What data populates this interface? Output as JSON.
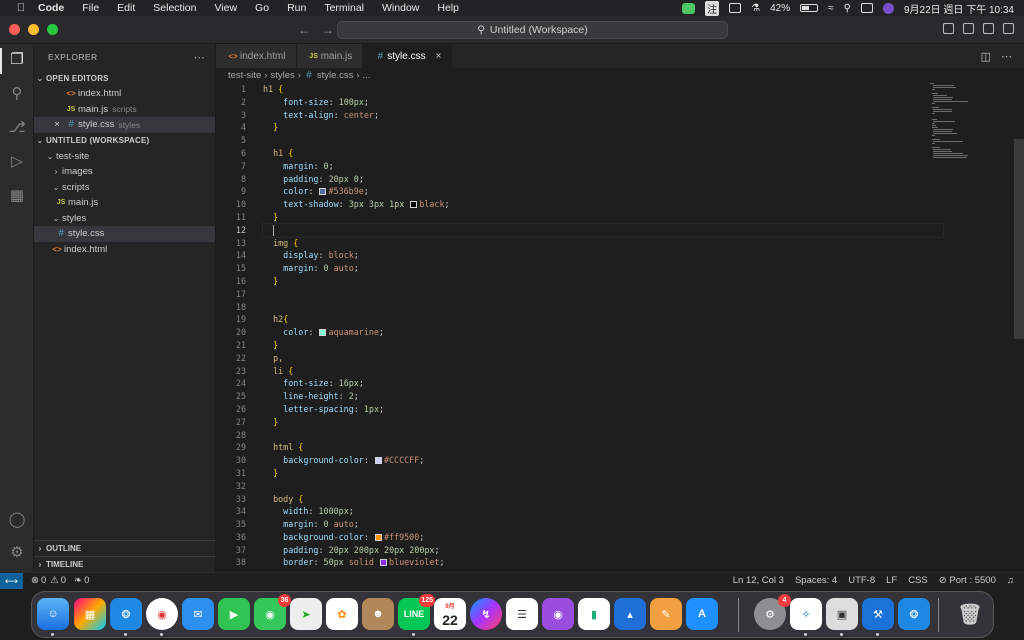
{
  "menubar": {
    "app_name": "Code",
    "items": [
      "File",
      "Edit",
      "Selection",
      "View",
      "Go",
      "Run",
      "Terminal",
      "Window",
      "Help"
    ],
    "ime": "注",
    "battery": "42%",
    "datetime": "9月22日 週日 下午 10:34"
  },
  "titlebar": {
    "search_text": "Untitled (Workspace)"
  },
  "explorer": {
    "title": "EXPLORER",
    "open_editors_label": "OPEN EDITORS",
    "open_editors": [
      {
        "name": "index.html",
        "desc": "",
        "icon": "html"
      },
      {
        "name": "main.js",
        "desc": "scripts",
        "icon": "js"
      },
      {
        "name": "style.css",
        "desc": "styles",
        "icon": "css"
      }
    ],
    "workspace_label": "UNTITLED (WORKSPACE)",
    "tree": {
      "root": "test-site",
      "images": "images",
      "scripts": "scripts",
      "main_js": "main.js",
      "styles": "styles",
      "style_css": "style.css",
      "index_html": "index.html"
    },
    "outline_label": "OUTLINE",
    "timeline_label": "TIMELINE"
  },
  "tabs": [
    {
      "label": "index.html",
      "icon": "html"
    },
    {
      "label": "main.js",
      "icon": "js"
    },
    {
      "label": "style.css",
      "icon": "css"
    }
  ],
  "breadcrumbs": [
    "test-site",
    "styles",
    "style.css",
    "..."
  ],
  "cursor_line": 12,
  "status": {
    "errors": "0",
    "warnings": "0",
    "ports": "0",
    "position": "Ln 12, Col 3",
    "spaces": "Spaces: 4",
    "encoding": "UTF-8",
    "eol": "LF",
    "language": "CSS",
    "port": "Port : 5500"
  },
  "dock": {
    "badges": {
      "messages": "36",
      "line": "125",
      "calendar_day": "22",
      "calendar_month": "9月",
      "settings": "4"
    }
  },
  "colors": {
    "accent_blue": "#0e639c",
    "swatch_536b9e": "#536b9e",
    "swatch_black": "#000000",
    "swatch_aquamarine": "#7fffd4",
    "swatch_cccccc": "#CCCCFF",
    "swatch_ff9500": "#ff9500",
    "swatch_blueviolet": "#8a2be2"
  },
  "code_lines": [
    "h1 {",
    "    font-size: 100px;",
    "    text-align: center;",
    "  }",
    "",
    "  h1 {",
    "    margin: 0;",
    "    padding: 20px 0;",
    "    color: #536b9e;",
    "    text-shadow: 3px 3px 1px black;",
    "  }",
    "",
    "  img {",
    "    display: block;",
    "    margin: 0 auto;",
    "  }",
    "",
    "",
    "  h2{",
    "    color: aquamarine;",
    "  }",
    "  p,",
    "  li {",
    "    font-size: 16px;",
    "    line-height: 2;",
    "    letter-spacing: 1px;",
    "  }",
    "",
    "  html {",
    "    background-color: #CCCCFF;",
    "  }",
    "",
    "  body {",
    "    width: 1000px;",
    "    margin: 0 auto;",
    "    background-color: #ff9500;",
    "    padding: 20px 200px 20px 200px;",
    "    border: 50px solid blueviolet;"
  ]
}
